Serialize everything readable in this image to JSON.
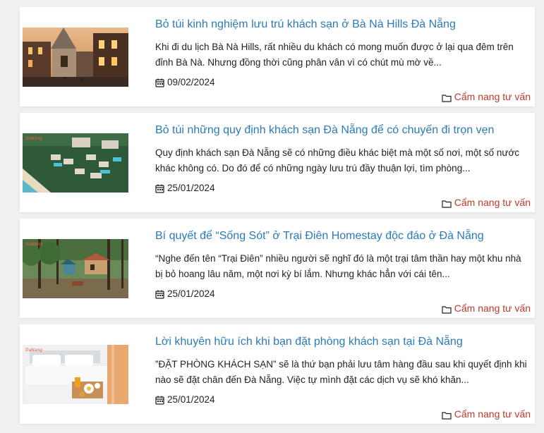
{
  "posts": [
    {
      "title": "Bỏ túi kinh nghiệm lưu trú khách sạn ở Bà Nà Hills Đà Nẵng",
      "excerpt": "Khi đi du lịch Bà Nà Hills, rất nhiều du khách có mong muốn được ở lại qua đêm trên đỉnh Bà Nà. Nhưng đồng thời cũng phân vân vì có chút mù mờ về...",
      "date": "09/02/2024",
      "category": "Cẩm nang tư vấn",
      "thumbnail": "french-village-photo"
    },
    {
      "title": "Bỏ túi những quy định khách sạn Đà Nẵng để có chuyến đi trọn vẹn",
      "excerpt": "Quy định khách sạn Đà Nẵng sẽ có những điều khác biệt mà một số nơi, một số nước khác không có. Do đó để có những ngày lưu trú đầy thuận lợi, tìm phòng...",
      "date": "25/01/2024",
      "category": "Cẩm nang tư vấn",
      "thumbnail": "beach-resort-photo"
    },
    {
      "title": "Bí quyết để “Sống Sót” ở Trại Điên Homestay độc đáo ở Đà Nẵng",
      "excerpt": "“Nghe đến tên “Trại Điên” nhiều người sẽ nghĩ đó là một trại tâm thần hay một khu nhà bị bỏ hoang lâu năm, một nơi kỳ bí lắm. Nhưng khác hẳn với cái tên...",
      "date": "25/01/2024",
      "category": "Cẩm nang tư vấn",
      "thumbnail": "forest-homestay-photo"
    },
    {
      "title": "Lời khuyên hữu ích khi bạn đặt phòng khách sạn tại Đà Nẵng",
      "excerpt": "”ĐẶT PHÒNG KHÁCH SẠN” sẽ là thứ bạn phải lưu tâm hàng đầu sau khi quyết định khi nào sẽ đặt chân đến Đà Nẵng. Việc tự mình đặt các dịch vụ sẽ khó khăn...",
      "date": "25/01/2024",
      "category": "Cẩm nang tư vấn",
      "thumbnail": "hotel-room-breakfast-photo"
    }
  ],
  "colors": {
    "title": "#2b7bb9",
    "category": "#c0392b",
    "page_bg": "#f0f0f0"
  }
}
